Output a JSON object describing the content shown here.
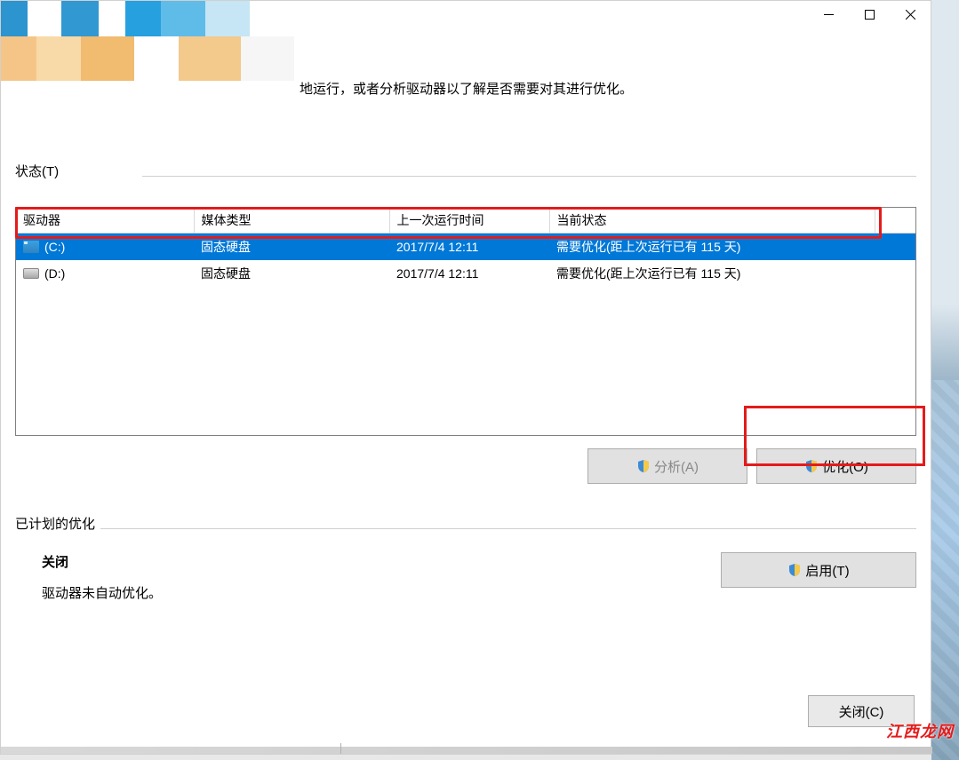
{
  "description_fragment": "地运行，或者分析驱动器以了解是否需要对其进行优化。",
  "status_section_label": "状态(T)",
  "columns": {
    "drive": "驱动器",
    "media": "媒体类型",
    "last_run": "上一次运行时间",
    "status": "当前状态"
  },
  "drives": [
    {
      "name": "(C:)",
      "icon": "sys",
      "media": "固态硬盘",
      "last_run": "2017/7/4 12:11",
      "status": "需要优化(距上次运行已有 115 天)",
      "selected": true
    },
    {
      "name": "(D:)",
      "icon": "hdd",
      "media": "固态硬盘",
      "last_run": "2017/7/4 12:11",
      "status": "需要优化(距上次运行已有 115 天)",
      "selected": false
    }
  ],
  "buttons": {
    "analyze": "分析(A)",
    "optimize": "优化(O)",
    "enable": "启用(T)",
    "close": "关闭(C)"
  },
  "scheduled": {
    "section_label": "已计划的优化",
    "state": "关闭",
    "note": "驱动器未自动优化。"
  },
  "watermark": "江西龙网"
}
